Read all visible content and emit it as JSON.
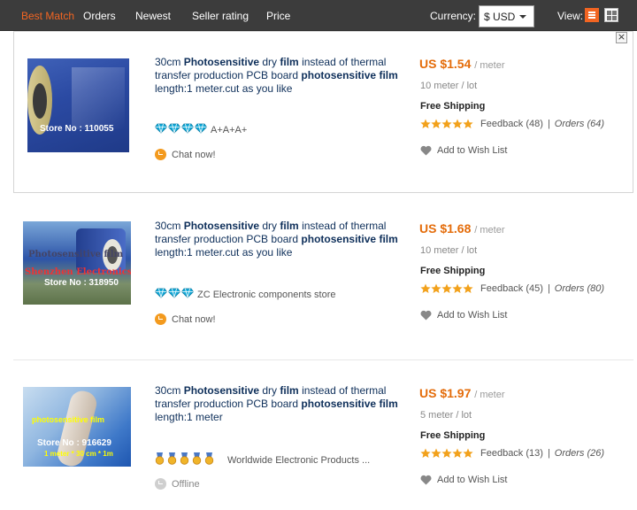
{
  "toolbar": {
    "sort_options": [
      "Best Match",
      "Orders",
      "Newest",
      "Seller rating",
      "Price"
    ],
    "currency_label": "Currency:",
    "currency_value": "$ USD",
    "view_label": "View:",
    "active_color": "#f26522"
  },
  "items": [
    {
      "title_parts": [
        {
          "t": "30cm ",
          "b": false
        },
        {
          "t": "Photosensitive",
          "b": true
        },
        {
          "t": " dry ",
          "b": false
        },
        {
          "t": "film",
          "b": true
        },
        {
          "t": " instead of thermal transfer production PCB board ",
          "b": false
        },
        {
          "t": "photosensitive",
          "b": true
        },
        {
          "t": " ",
          "b": false
        },
        {
          "t": "film",
          "b": true
        },
        {
          "t": " length:1 meter.cut as you like",
          "b": false
        }
      ],
      "thumb_text": "Store No : 110055",
      "seller_rank": "A+A+A+",
      "rank_icon": "diamond",
      "rank_count": 4,
      "chat": "Chat now!",
      "chat_online": true,
      "price": "US $1.54",
      "price_unit": "/ meter",
      "lot": "10 meter / lot",
      "shipping": "Free Shipping",
      "feedback": "Feedback (48)",
      "orders": "Orders (64)",
      "wishlist": "Add to Wish List",
      "rating": 5
    },
    {
      "title_parts": [
        {
          "t": "30cm ",
          "b": false
        },
        {
          "t": "Photosensitive",
          "b": true
        },
        {
          "t": " dry ",
          "b": false
        },
        {
          "t": "film",
          "b": true
        },
        {
          "t": " instead of thermal transfer production PCB board ",
          "b": false
        },
        {
          "t": "photosensitive",
          "b": true
        },
        {
          "t": " ",
          "b": false
        },
        {
          "t": "film",
          "b": true
        },
        {
          "t": " length:1 meter.cut as you like",
          "b": false
        }
      ],
      "thumb_text": "Store No : 318950",
      "thumb_overlay_1": "Photosensitive film",
      "thumb_overlay_2": "Shenzhen Electronics",
      "seller_rank": "ZC Electronic components store",
      "rank_icon": "diamond",
      "rank_count": 3,
      "chat": "Chat now!",
      "chat_online": true,
      "price": "US $1.68",
      "price_unit": "/ meter",
      "lot": "10 meter / lot",
      "shipping": "Free Shipping",
      "feedback": "Feedback (45)",
      "orders": "Orders (80)",
      "wishlist": "Add to Wish List",
      "rating": 5
    },
    {
      "title_parts": [
        {
          "t": "30cm ",
          "b": false
        },
        {
          "t": "Photosensitive",
          "b": true
        },
        {
          "t": " dry ",
          "b": false
        },
        {
          "t": "film",
          "b": true
        },
        {
          "t": " instead of thermal transfer production PCB board ",
          "b": false
        },
        {
          "t": "photosensitive",
          "b": true
        },
        {
          "t": " ",
          "b": false
        },
        {
          "t": "film",
          "b": true
        },
        {
          "t": " length:1 meter",
          "b": false
        }
      ],
      "thumb_text": "Store No : 916629",
      "thumb_overlay_1": "photosensitive film",
      "thumb_overlay_2": "1 meter * 30 cm * 1m",
      "seller_rank": "Worldwide Electronic Products ...",
      "rank_icon": "medal",
      "rank_count": 5,
      "chat": "Offline",
      "chat_online": false,
      "price": "US $1.97",
      "price_unit": "/ meter",
      "lot": "5 meter / lot",
      "shipping": "Free Shipping",
      "feedback": "Feedback (13)",
      "orders": "Orders (26)",
      "wishlist": "Add to Wish List",
      "rating": 5
    }
  ],
  "colors": {
    "price": "#e46c0a",
    "title": "#0e2f5a",
    "star": "#f2a11b",
    "diamond": "#12a9d8"
  }
}
